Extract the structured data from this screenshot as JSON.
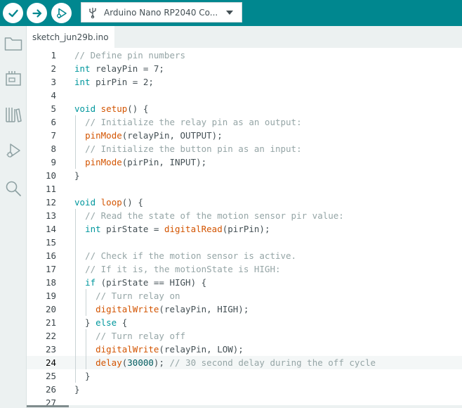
{
  "toolbar": {
    "verify": {
      "icon": "check-icon"
    },
    "upload": {
      "icon": "arrow-right-icon"
    },
    "debug": {
      "icon": "debug-play-icon"
    },
    "board": {
      "label": "Arduino Nano RP2040 Co...",
      "icon": "usb-icon"
    }
  },
  "sidebar": {
    "items": [
      {
        "icon": "folder-icon"
      },
      {
        "icon": "board-manager-icon"
      },
      {
        "icon": "library-icon"
      },
      {
        "icon": "debug-icon"
      },
      {
        "icon": "search-icon"
      }
    ]
  },
  "tabs": [
    {
      "label": "sketch_jun29b.ino",
      "active": true
    }
  ],
  "editor": {
    "current_line": 24,
    "colors": {
      "comment": "#95a5a6",
      "keyword": "#00979d",
      "function": "#d35400",
      "text": "#434f54",
      "number": "#005c5f"
    },
    "lines": [
      {
        "num": "1",
        "tokens": [
          {
            "t": "c",
            "v": "// Define pin numbers"
          }
        ]
      },
      {
        "num": "2",
        "tokens": [
          {
            "t": "k",
            "v": "int"
          },
          {
            "t": "p",
            "v": " relayPin = 7;"
          }
        ]
      },
      {
        "num": "3",
        "tokens": [
          {
            "t": "k",
            "v": "int"
          },
          {
            "t": "p",
            "v": " pirPin = 2;"
          }
        ]
      },
      {
        "num": "4",
        "tokens": []
      },
      {
        "num": "5",
        "tokens": [
          {
            "t": "k",
            "v": "void"
          },
          {
            "t": "p",
            "v": " "
          },
          {
            "t": "f",
            "v": "setup"
          },
          {
            "t": "p",
            "v": "() {"
          }
        ]
      },
      {
        "num": "6",
        "tokens": [
          {
            "t": "p",
            "v": "  "
          },
          {
            "t": "c",
            "v": "// Initialize the relay pin as an output:"
          }
        ]
      },
      {
        "num": "7",
        "tokens": [
          {
            "t": "p",
            "v": "  "
          },
          {
            "t": "f",
            "v": "pinMode"
          },
          {
            "t": "p",
            "v": "(relayPin, OUTPUT);"
          }
        ]
      },
      {
        "num": "8",
        "tokens": [
          {
            "t": "p",
            "v": "  "
          },
          {
            "t": "c",
            "v": "// Initialize the button pin as an input:"
          }
        ]
      },
      {
        "num": "9",
        "tokens": [
          {
            "t": "p",
            "v": "  "
          },
          {
            "t": "f",
            "v": "pinMode"
          },
          {
            "t": "p",
            "v": "(pirPin, INPUT);"
          }
        ]
      },
      {
        "num": "10",
        "tokens": [
          {
            "t": "p",
            "v": "}"
          }
        ]
      },
      {
        "num": "11",
        "tokens": []
      },
      {
        "num": "12",
        "tokens": [
          {
            "t": "k",
            "v": "void"
          },
          {
            "t": "p",
            "v": " "
          },
          {
            "t": "f",
            "v": "loop"
          },
          {
            "t": "p",
            "v": "() {"
          }
        ]
      },
      {
        "num": "13",
        "tokens": [
          {
            "t": "p",
            "v": "  "
          },
          {
            "t": "c",
            "v": "// Read the state of the motion sensor pir value:"
          }
        ]
      },
      {
        "num": "14",
        "tokens": [
          {
            "t": "p",
            "v": "  "
          },
          {
            "t": "k",
            "v": "int"
          },
          {
            "t": "p",
            "v": " pirState = "
          },
          {
            "t": "f",
            "v": "digitalRead"
          },
          {
            "t": "p",
            "v": "(pirPin);"
          }
        ]
      },
      {
        "num": "15",
        "tokens": []
      },
      {
        "num": "16",
        "tokens": [
          {
            "t": "p",
            "v": "  "
          },
          {
            "t": "c",
            "v": "// Check if the motion sensor is active."
          }
        ]
      },
      {
        "num": "17",
        "tokens": [
          {
            "t": "p",
            "v": "  "
          },
          {
            "t": "c",
            "v": "// If it is, the motionState is HIGH:"
          }
        ]
      },
      {
        "num": "18",
        "tokens": [
          {
            "t": "p",
            "v": "  "
          },
          {
            "t": "k",
            "v": "if"
          },
          {
            "t": "p",
            "v": " (pirState == HIGH) {"
          }
        ]
      },
      {
        "num": "19",
        "tokens": [
          {
            "t": "p",
            "v": "    "
          },
          {
            "t": "c",
            "v": "// Turn relay on"
          }
        ]
      },
      {
        "num": "20",
        "tokens": [
          {
            "t": "p",
            "v": "    "
          },
          {
            "t": "f",
            "v": "digitalWrite"
          },
          {
            "t": "p",
            "v": "(relayPin, HIGH);"
          }
        ]
      },
      {
        "num": "21",
        "tokens": [
          {
            "t": "p",
            "v": "  } "
          },
          {
            "t": "k",
            "v": "else"
          },
          {
            "t": "p",
            "v": " {"
          }
        ]
      },
      {
        "num": "22",
        "tokens": [
          {
            "t": "p",
            "v": "    "
          },
          {
            "t": "c",
            "v": "// Turn relay off"
          }
        ]
      },
      {
        "num": "23",
        "tokens": [
          {
            "t": "p",
            "v": "    "
          },
          {
            "t": "f",
            "v": "digitalWrite"
          },
          {
            "t": "p",
            "v": "(relayPin, LOW);"
          }
        ]
      },
      {
        "num": "24",
        "tokens": [
          {
            "t": "p",
            "v": "    "
          },
          {
            "t": "f",
            "v": "delay"
          },
          {
            "t": "p",
            "v": "("
          },
          {
            "t": "n",
            "v": "30000"
          },
          {
            "t": "p",
            "v": "); "
          },
          {
            "t": "c",
            "v": "// 30 second delay during the off cycle"
          }
        ]
      },
      {
        "num": "25",
        "tokens": [
          {
            "t": "p",
            "v": "  }"
          }
        ]
      },
      {
        "num": "26",
        "tokens": [
          {
            "t": "p",
            "v": "}"
          }
        ]
      },
      {
        "num": "27",
        "tokens": []
      }
    ]
  }
}
